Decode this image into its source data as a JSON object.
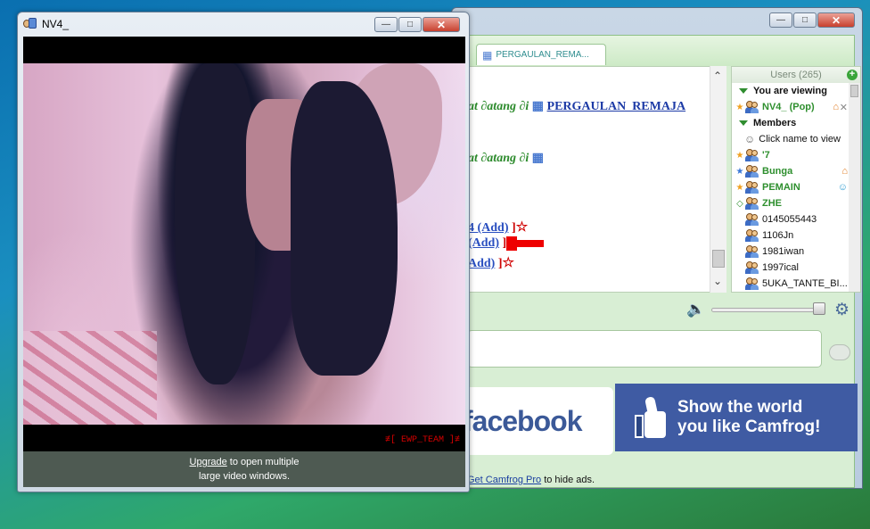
{
  "room_window": {
    "tab_label": "PERGAULAN_REMA...",
    "chat": {
      "line1": {
        "greeting": "at ∂atang ∂i",
        "room_link": "PERGAULAN_REMAJA"
      },
      "line2": {
        "greeting": "at ∂atang ∂i"
      },
      "line3": {
        "add": "4 (Add)",
        "close": "]"
      },
      "line4": {
        "add": "(Add)",
        "close": "]"
      },
      "line5": {
        "add": "Add)",
        "close": "]"
      }
    },
    "users": {
      "header": "Users (265)",
      "you_are_viewing": "You are viewing",
      "members": "Members",
      "click_hint": "Click name to view",
      "list": [
        {
          "name": "NV4_ (Pop)",
          "style": "green",
          "mark": "★",
          "mark_color": "#f0a020",
          "right": "⌂",
          "right2": "✕"
        },
        {
          "name": "'7",
          "style": "green",
          "mark": "★",
          "mark_color": "#f0a020",
          "right": ""
        },
        {
          "name": "Bunga",
          "style": "green",
          "mark": "★",
          "mark_color": "#3a78d8",
          "right": "⌂"
        },
        {
          "name": "PEMAIN",
          "style": "green",
          "mark": "★",
          "mark_color": "#f0a020",
          "right": "☺"
        },
        {
          "name": "ZHE",
          "style": "green",
          "mark": "◇",
          "mark_color": "#2e8f2e",
          "right": ""
        },
        {
          "name": "0145055443",
          "style": "plain",
          "mark": "",
          "right": ""
        },
        {
          "name": "1106Jn",
          "style": "plain",
          "mark": "",
          "right": ""
        },
        {
          "name": "1981iwan",
          "style": "plain",
          "mark": "",
          "right": ""
        },
        {
          "name": "1997ical",
          "style": "plain",
          "mark": "",
          "right": ""
        },
        {
          "name": "5UKA_TANTE_BI...",
          "style": "plain",
          "mark": "",
          "right": ""
        }
      ]
    },
    "ads": {
      "fb_logo": "facebook",
      "promo_line1": "Show the world",
      "promo_line2": "you like Camfrog!",
      "pro_link": "Get Camfrog Pro",
      "pro_suffix": " to hide ads."
    }
  },
  "video_window": {
    "title": "NV4_",
    "tag": "≢[ EWP_TEAM ]≢",
    "upgrade_link": "Upgrade",
    "upgrade_suffix": " to open multiple",
    "upgrade_line2": "large video windows."
  },
  "colors": {
    "accent_green": "#2e8f2e",
    "link_blue": "#1c3aa6",
    "facebook_blue": "#3b5998"
  }
}
